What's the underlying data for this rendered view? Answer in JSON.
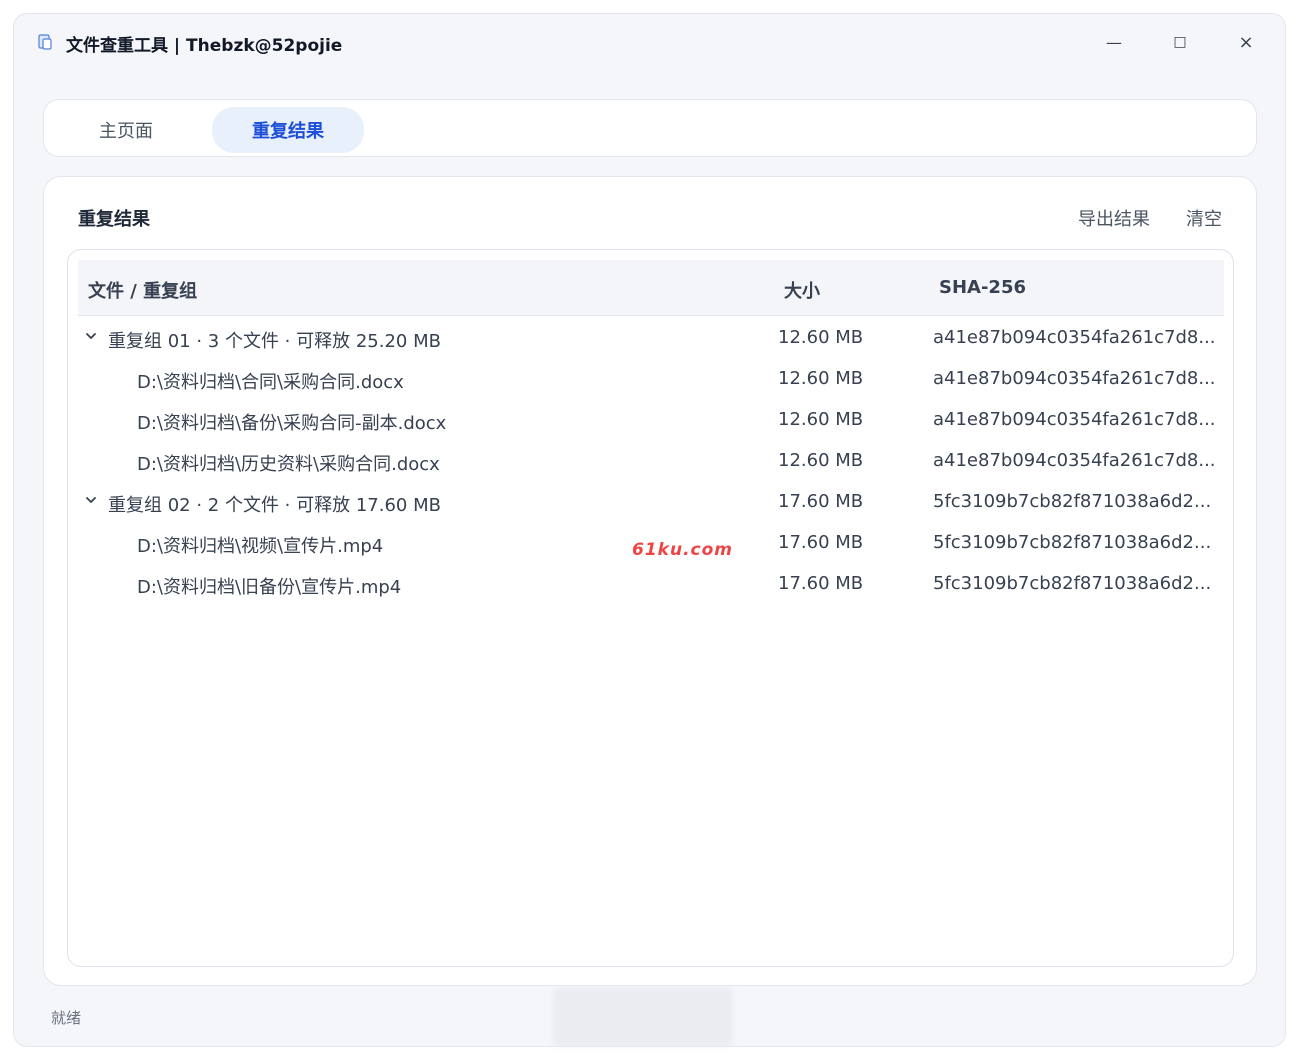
{
  "window": {
    "title": "文件查重工具 | Thebzk@52pojie",
    "minimize": "—",
    "maximize": "□",
    "close": "×"
  },
  "tabs": [
    {
      "label": "主页面",
      "active": false
    },
    {
      "label": "重复结果",
      "active": true
    }
  ],
  "panel": {
    "title": "重复结果",
    "export_label": "导出结果",
    "clear_label": "清空"
  },
  "table": {
    "columns": [
      "文件 / 重复组",
      "大小",
      "SHA-256"
    ],
    "rows": [
      {
        "type": "group",
        "name": "重复组 01 · 3 个文件 · 可释放 25.20 MB",
        "size": "12.60 MB",
        "hash": "a41e87b094c0354fa261c7d8..."
      },
      {
        "type": "file",
        "name": "D:\\资料归档\\合同\\采购合同.docx",
        "size": "12.60 MB",
        "hash": "a41e87b094c0354fa261c7d8..."
      },
      {
        "type": "file",
        "name": "D:\\资料归档\\备份\\采购合同-副本.docx",
        "size": "12.60 MB",
        "hash": "a41e87b094c0354fa261c7d8..."
      },
      {
        "type": "file",
        "name": "D:\\资料归档\\历史资料\\采购合同.docx",
        "size": "12.60 MB",
        "hash": "a41e87b094c0354fa261c7d8..."
      },
      {
        "type": "group",
        "name": "重复组 02 · 2 个文件 · 可释放 17.60 MB",
        "size": "17.60 MB",
        "hash": "5fc3109b7cb82f871038a6d2..."
      },
      {
        "type": "file",
        "name": "D:\\资料归档\\视频\\宣传片.mp4",
        "size": "17.60 MB",
        "hash": "5fc3109b7cb82f871038a6d2..."
      },
      {
        "type": "file",
        "name": "D:\\资料归档\\旧备份\\宣传片.mp4",
        "size": "17.60 MB",
        "hash": "5fc3109b7cb82f871038a6d2..."
      }
    ]
  },
  "watermark": "61ku.com",
  "status": "就绪",
  "colors": {
    "accent": "#1d4ed8",
    "active_tab_bg": "#e8f0fc",
    "window_bg": "#f4f6fa",
    "watermark": "#ef4444"
  }
}
